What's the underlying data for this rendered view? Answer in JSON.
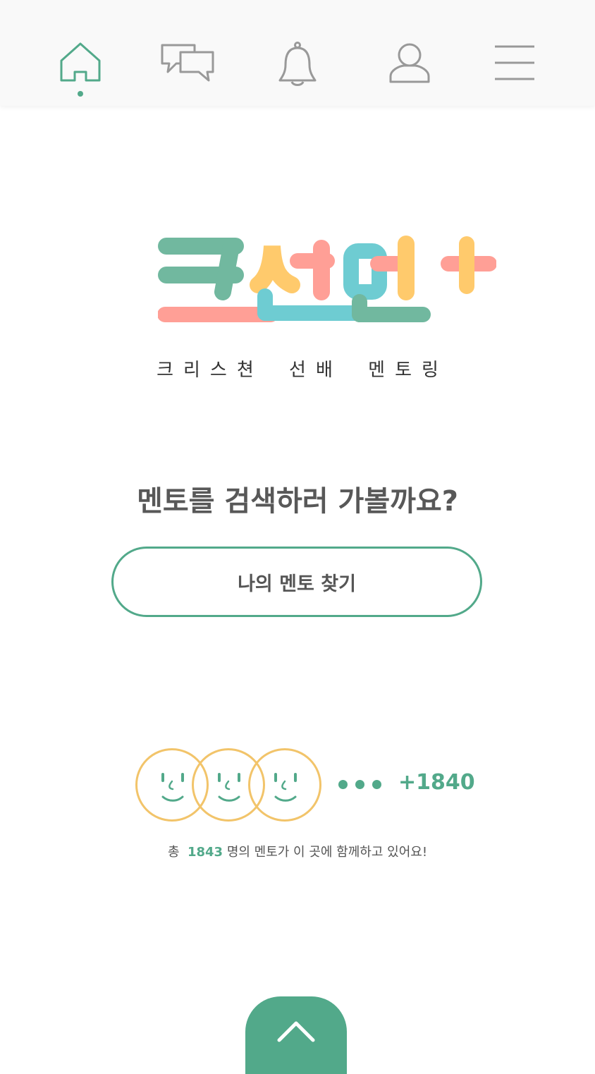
{
  "nav": {
    "items": [
      {
        "name": "home",
        "icon": "home-icon",
        "active": true
      },
      {
        "name": "chat",
        "icon": "chat-bubbles-icon",
        "active": false
      },
      {
        "name": "notifications",
        "icon": "bell-icon",
        "active": false
      },
      {
        "name": "profile",
        "icon": "user-icon",
        "active": false
      },
      {
        "name": "menu",
        "icon": "hamburger-menu-icon",
        "active": false
      }
    ],
    "active_color": "#52a98a",
    "inactive_color": "#999999"
  },
  "logo": {
    "text": "크선멘+",
    "colors": [
      "#52a98a",
      "#ff8a80",
      "#4fc1c9",
      "#ffbf4d"
    ]
  },
  "subtitle": "크리스쳔 선배 멘토링",
  "question": "멘토를 검색하러 가볼까요?",
  "find_button_label": "나의 멘토 찾기",
  "mentors": {
    "extra_count": "+1840",
    "total_prefix": "총",
    "total_number": "1843",
    "total_suffix": "명의 멘토가 이 곳에 함께하고 있어요!"
  },
  "colors": {
    "accent": "#52a98a",
    "face_outline": "#f2c46a",
    "text": "#555555"
  }
}
